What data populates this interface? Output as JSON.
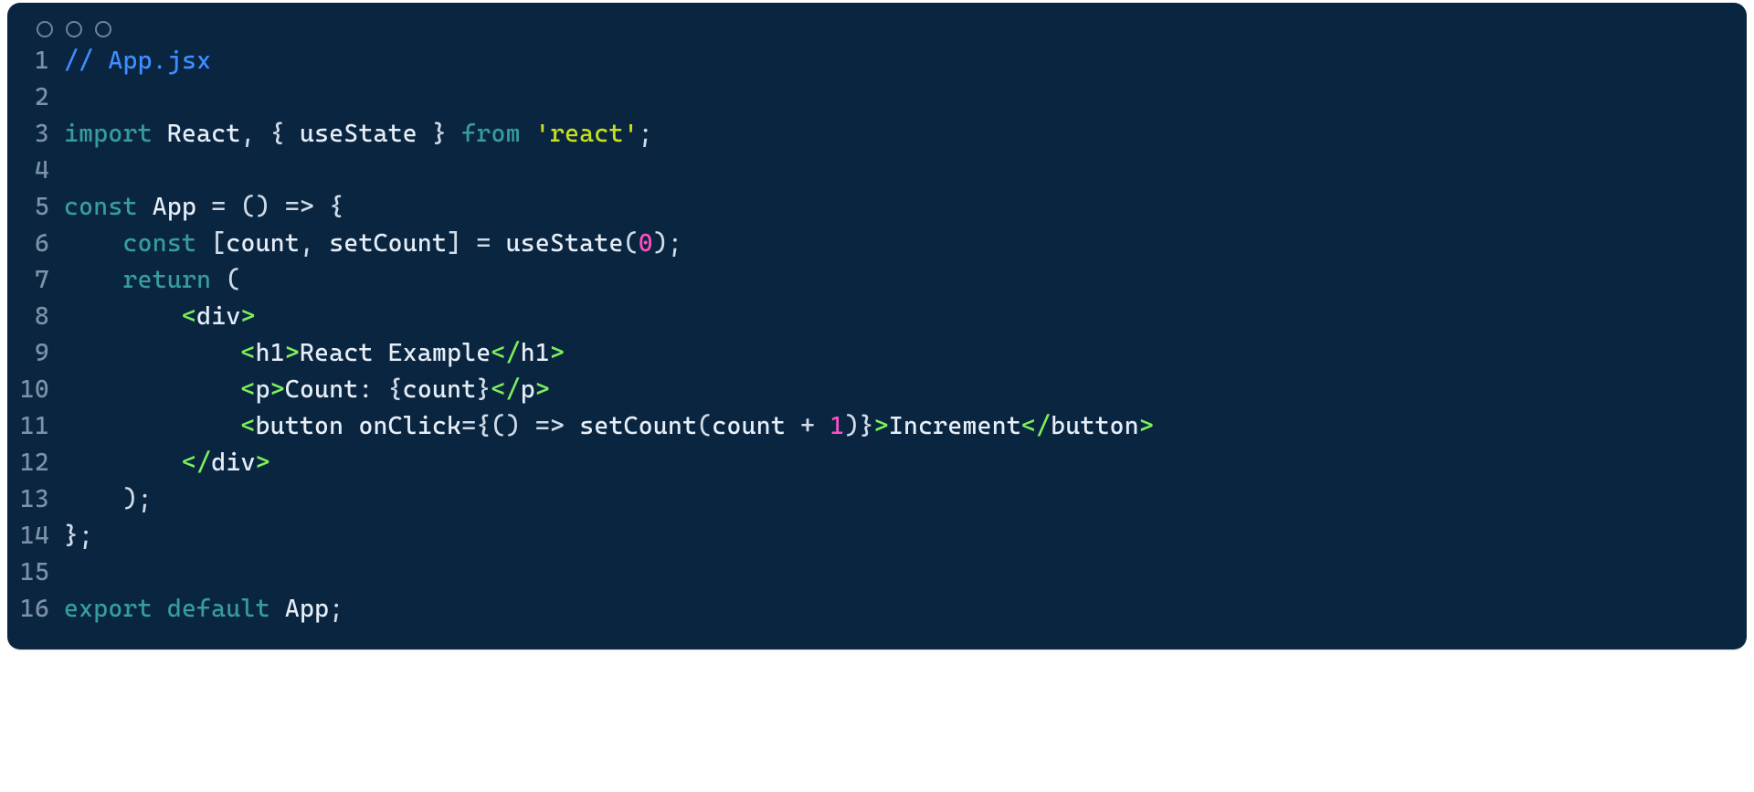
{
  "colors": {
    "background": "#0a2540",
    "lineNumber": "#7d92a8",
    "default": "#e6eef7",
    "comment": "#3d8eff",
    "keyword": "#369c9c",
    "string": "#c6e01a",
    "number": "#ff4fc4",
    "tagDelimiter": "#7cf05a"
  },
  "lineNumbers": [
    "1",
    "2",
    "3",
    "4",
    "5",
    "6",
    "7",
    "8",
    "9",
    "10",
    "11",
    "12",
    "13",
    "14",
    "15",
    "16"
  ],
  "code": {
    "l1": {
      "comment": "// App.jsx"
    },
    "l3": {
      "kw_import": "import",
      "sp1": " ",
      "id_React": "React",
      "p_comma": ",",
      "sp2": " ",
      "p_lbrace": "{",
      "sp3": " ",
      "id_useState": "useState",
      "sp4": " ",
      "p_rbrace": "}",
      "sp5": " ",
      "kw_from": "from",
      "sp6": " ",
      "str_react": "'react'",
      "p_semi": ";"
    },
    "l5": {
      "kw_const": "const",
      "sp1": " ",
      "id_App": "App",
      "sp2": " ",
      "p_eq": "=",
      "sp3": " ",
      "p_lp": "(",
      "p_rp": ")",
      "sp4": " ",
      "p_arrow": "=>",
      "sp5": " ",
      "p_lbrace": "{"
    },
    "l6": {
      "indent": "    ",
      "kw_const": "const",
      "sp1": " ",
      "p_lbrack": "[",
      "id_count": "count",
      "p_comma": ",",
      "sp2": " ",
      "id_setCount": "setCount",
      "p_rbrack": "]",
      "sp3": " ",
      "p_eq": "=",
      "sp4": " ",
      "id_useState": "useState",
      "p_lp": "(",
      "num_zero": "0",
      "p_rp": ")",
      "p_semi": ";"
    },
    "l7": {
      "indent": "    ",
      "kw_return": "return",
      "sp1": " ",
      "p_lp": "("
    },
    "l8": {
      "indent": "        ",
      "t_open": "<",
      "tag_div": "div",
      "t_close": ">"
    },
    "l9": {
      "indent": "            ",
      "t_open": "<",
      "tag_h1": "h1",
      "t_close": ">",
      "txt": "React Example",
      "t_open2": "</",
      "tag_h1b": "h1",
      "t_close2": ">"
    },
    "l10": {
      "indent": "            ",
      "t_open": "<",
      "tag_p": "p",
      "t_close": ">",
      "txt1": "Count: ",
      "p_lbrace": "{",
      "id_count": "count",
      "p_rbrace": "}",
      "t_open2": "</",
      "tag_p2": "p",
      "t_close2": ">"
    },
    "l11": {
      "indent": "            ",
      "t_open": "<",
      "tag_button": "button",
      "sp1": " ",
      "attr_onClick": "onClick",
      "p_eq": "=",
      "p_lbrace": "{",
      "p_lp": "(",
      "p_rp": ")",
      "sp2": " ",
      "p_arrow": "=>",
      "sp3": " ",
      "id_setCount": "setCount",
      "p_lp2": "(",
      "id_count": "count",
      "sp4": " ",
      "p_plus": "+",
      "sp5": " ",
      "num_one": "1",
      "p_rp2": ")",
      "p_rbrace": "}",
      "t_close": ">",
      "txt": "Increment",
      "t_open2": "</",
      "tag_button2": "button",
      "t_close2": ">"
    },
    "l12": {
      "indent": "        ",
      "t_open": "</",
      "tag_div": "div",
      "t_close": ">"
    },
    "l13": {
      "indent": "    ",
      "p_rp": ")",
      "p_semi": ";"
    },
    "l14": {
      "p_rbrace": "}",
      "p_semi": ";"
    },
    "l16": {
      "kw_export": "export",
      "sp1": " ",
      "kw_default": "default",
      "sp2": " ",
      "id_App": "App",
      "p_semi": ";"
    }
  }
}
